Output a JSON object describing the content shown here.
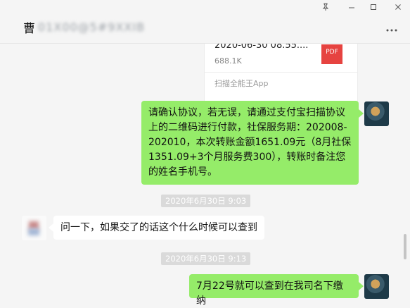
{
  "header": {
    "title_first_char": "曹",
    "title_blurred": "01X00@5#9XXIB",
    "pin_icon": "pin-icon",
    "minimize_icon": "minimize-icon",
    "maximize_icon": "maximize-icon",
    "close_icon": "close-icon",
    "more_icon": "more-icon"
  },
  "file_message": {
    "name": "2020-06-30 08.55....",
    "size": "688.1K",
    "badge": "PDF",
    "source": "扫描全能王App"
  },
  "messages": [
    {
      "side": "right",
      "text": "请确认协议，若无误，请通过支付宝扫描协议上的二维码进行付款，社保服务期：202008-202010，本次转账金额1651.09元（8月社保1351.09+3个月服务费300），转账时备注您的姓名手机号。"
    },
    {
      "timestamp": "2020年6月30日 9:03"
    },
    {
      "side": "left",
      "text": "问一下，如果交了的话这个什么时候可以查到"
    },
    {
      "timestamp": "2020年6月30日 9:13"
    },
    {
      "side": "right",
      "text": "7月22号就可以查到在我司名下缴纳"
    }
  ],
  "colors": {
    "bubble_green": "#95ec69",
    "bubble_white": "#ffffff",
    "background": "#f5f5f5",
    "timestamp_chip": "#dadada"
  }
}
